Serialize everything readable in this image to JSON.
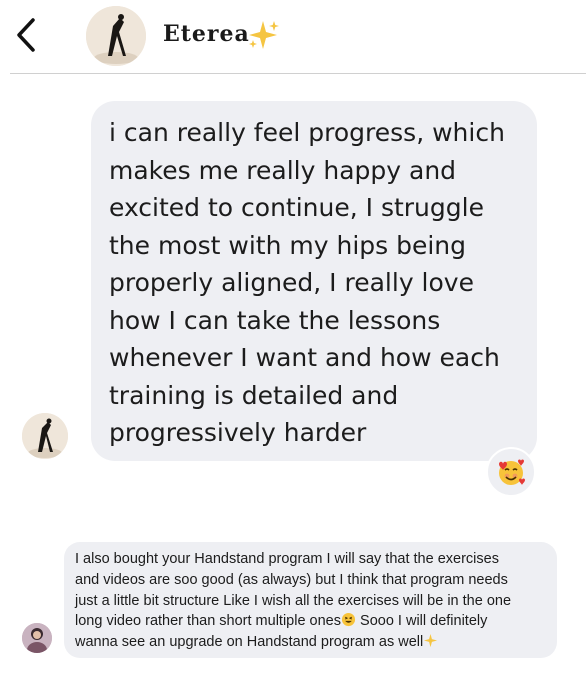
{
  "header": {
    "back_icon": "chevron-left-icon",
    "contact_name": "Eterea",
    "name_decoration": "sparkles-icon"
  },
  "messages": [
    {
      "lines": [
        "i can really feel progress, which",
        "makes me really happy and",
        "excited to continue, I struggle",
        "the most with my hips being",
        "properly aligned, I really love",
        "how I can take the lessons",
        "whenever I want and how each",
        "training is detailed and",
        "progressively harder"
      ],
      "reaction": "smiling-face-with-hearts-icon"
    },
    {
      "lines": [
        "I also bought your Handstand program I will say that the exercises",
        "and videos are soo good (as always) but I think that program needs",
        "just a little bit structure Like I wish all the exercises will be in the one",
        "long video rather than short multiple ones",
        " Sooo I will definitely",
        "wanna see an upgrade on Handstand program as well"
      ],
      "inline_emojis": [
        "grinning-squinting-face-icon",
        "sparkles-icon"
      ]
    }
  ],
  "colors": {
    "bubble": "#eeeff3",
    "divider": "#d0d0d0",
    "text": "#1c1c1c",
    "sparkle": "#f5c542"
  }
}
